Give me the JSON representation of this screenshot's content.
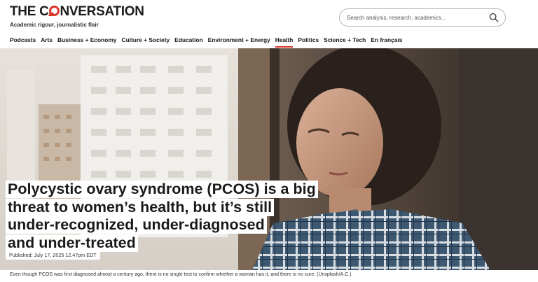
{
  "brand": {
    "logo_prefix": "THE C",
    "logo_suffix": "NVERSATION",
    "tagline": "Academic rigour, journalistic flair"
  },
  "search": {
    "placeholder": "Search analysis, research, academics..."
  },
  "nav": {
    "items": [
      {
        "label": "Podcasts"
      },
      {
        "label": "Arts"
      },
      {
        "label": "Business + Economy"
      },
      {
        "label": "Culture + Society"
      },
      {
        "label": "Education"
      },
      {
        "label": "Environment + Energy"
      },
      {
        "label": "Health"
      },
      {
        "label": "Politics"
      },
      {
        "label": "Science + Tech"
      },
      {
        "label": "En français"
      }
    ],
    "active": "Health"
  },
  "article": {
    "headline_lines": [
      "Polycystic ovary syndrome (PCOS) is a big",
      "threat to women’s health, but it’s still",
      "under-recognized, under-diagnosed",
      "and under-treated"
    ],
    "published": "Published: July 17, 2025 12.47pm EDT",
    "caption": "Even though PCOS was first diagnosed almost a century ago, there is no single test to confirm whether a woman has it, and there is no cure. (Unsplash/A.C.)"
  },
  "colors": {
    "brand_red": "#d8352a",
    "text": "#1a1a1a"
  }
}
